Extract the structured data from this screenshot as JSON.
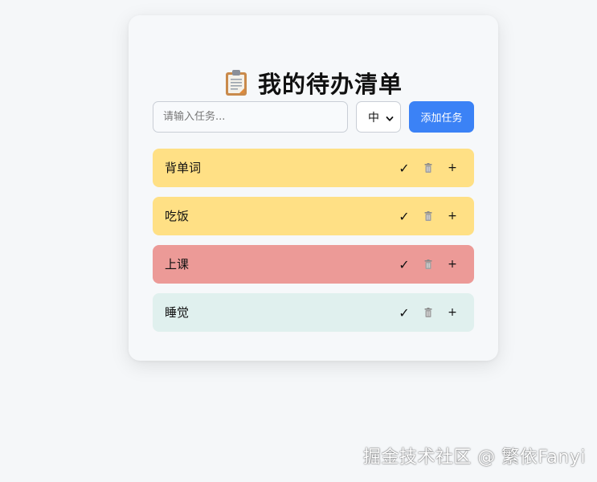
{
  "app": {
    "title": "我的待办清单",
    "title_icon": "clipboard-icon"
  },
  "form": {
    "input_placeholder": "请输入任务...",
    "input_value": "",
    "priority_selected": "中",
    "add_label": "添加任务",
    "add_color": "#3b82f6"
  },
  "tasks": [
    {
      "label": "背单词",
      "priority_color": "#ffe085",
      "done_icon": "✓",
      "trash_icon": "🗑",
      "plus_icon": "+"
    },
    {
      "label": "吃饭",
      "priority_color": "#ffe085",
      "done_icon": "✓",
      "trash_icon": "🗑",
      "plus_icon": "+"
    },
    {
      "label": "上课",
      "priority_color": "#ec9a97",
      "done_icon": "✓",
      "trash_icon": "🗑",
      "plus_icon": "+"
    },
    {
      "label": "睡觉",
      "priority_color": "#e0f0ee",
      "done_icon": "✓",
      "trash_icon": "🗑",
      "plus_icon": "+"
    }
  ],
  "watermark": "掘金技术社区 @ 繁依Fanyi"
}
